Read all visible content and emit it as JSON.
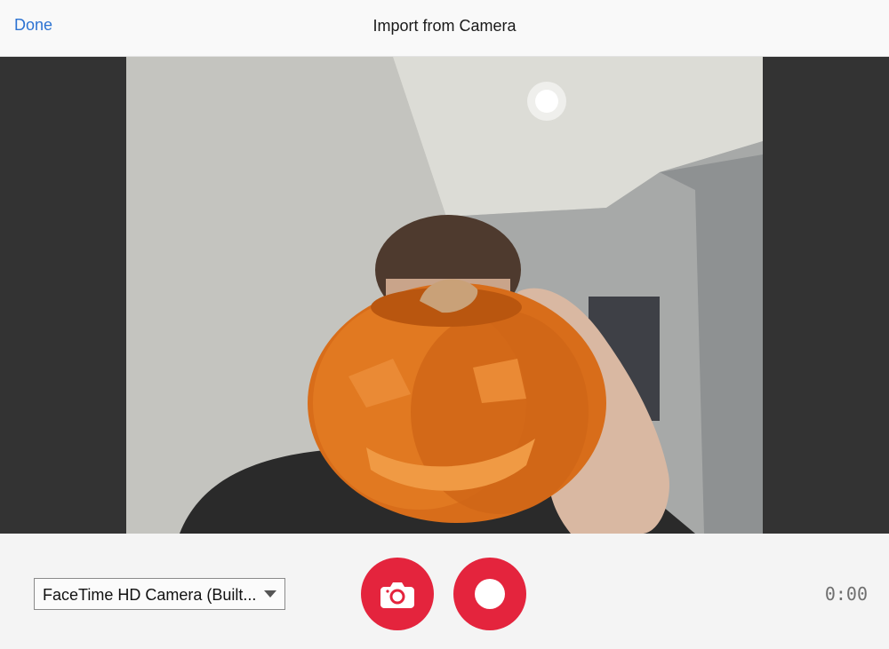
{
  "navbar": {
    "done_label": "Done",
    "title": "Import from Camera"
  },
  "preview": {
    "description_icon": "camera-preview-image"
  },
  "controls": {
    "camera_source": "FaceTime HD Camera (Built...",
    "photo_button_icon": "camera-icon",
    "record_button_icon": "record-icon",
    "timer": "0:00"
  },
  "colors": {
    "accent": "#2d73d2",
    "record_red": "#e4243d",
    "letterbox": "#333333"
  }
}
